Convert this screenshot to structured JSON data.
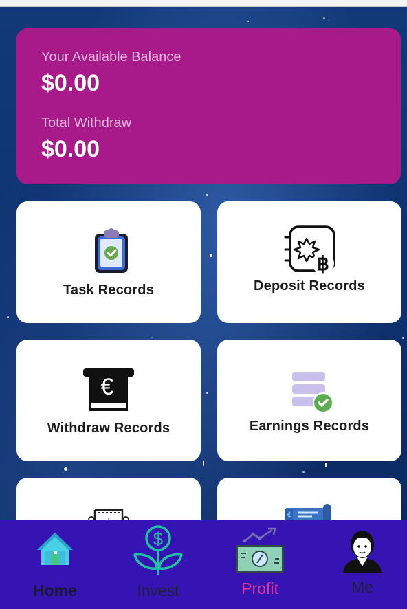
{
  "balance": {
    "available_label": "Your Available Balance",
    "available_value": "$0.00",
    "withdraw_label": "Total Withdraw",
    "withdraw_value": "$0.00"
  },
  "records": [
    {
      "label": "Task Records",
      "icon": "clipboard-check-icon"
    },
    {
      "label": "Deposit Records",
      "icon": "bitcoin-crypto-icon"
    },
    {
      "label": "Withdraw Records",
      "icon": "euro-atm-icon"
    },
    {
      "label": "Earnings Records",
      "icon": "database-check-icon"
    },
    {
      "label": "",
      "icon": "trophy-icon"
    },
    {
      "label": "",
      "icon": "banknote-icon"
    }
  ],
  "nav": [
    {
      "label": "Home",
      "icon": "home-icon",
      "color": "#1a1a2e"
    },
    {
      "label": "Invest",
      "icon": "money-plant-icon",
      "color": "#1f1f3a"
    },
    {
      "label": "Profit",
      "icon": "profit-cash-icon",
      "color": "#e0359e"
    },
    {
      "label": "Me",
      "icon": "user-avatar-icon",
      "color": "#1f1f3a"
    }
  ],
  "colors": {
    "balance_card": "#a8198a",
    "nav_background": "#3614b4",
    "active_nav": "#e0359e"
  }
}
